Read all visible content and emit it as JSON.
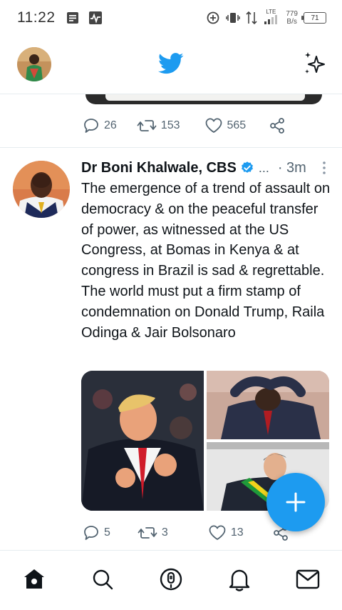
{
  "status_bar": {
    "time": "11:22",
    "network_type": "LTE",
    "speed_value": "779",
    "speed_unit": "B/s",
    "battery": "71"
  },
  "top_bar": {
    "logo_icon": "twitter-bird-icon",
    "sparkle_icon": "sparkle-icon"
  },
  "previous_tweet": {
    "replies": "26",
    "retweets": "153",
    "likes": "565"
  },
  "tweet": {
    "author_name": "Dr Boni Khalwale, CBS",
    "verified": true,
    "truncation": "...",
    "time": "· 3m",
    "text": "The emergence of a trend of assault on democracy & on the peaceful transfer of power, as witnessed at the US Congress, at Bomas in Kenya & at congress in Brazil is sad & regrettable. The world must put a firm stamp of condemnation on Donald Trump, Raila Odinga & Jair Bolsonaro",
    "replies": "5",
    "retweets": "3",
    "likes": "13"
  },
  "bottom_nav": {
    "items": [
      "home-icon",
      "search-icon",
      "spaces-icon",
      "notifications-icon",
      "messages-icon"
    ]
  },
  "colors": {
    "accent": "#1d9bf0",
    "text": "#0f1419",
    "muted": "#536471"
  }
}
